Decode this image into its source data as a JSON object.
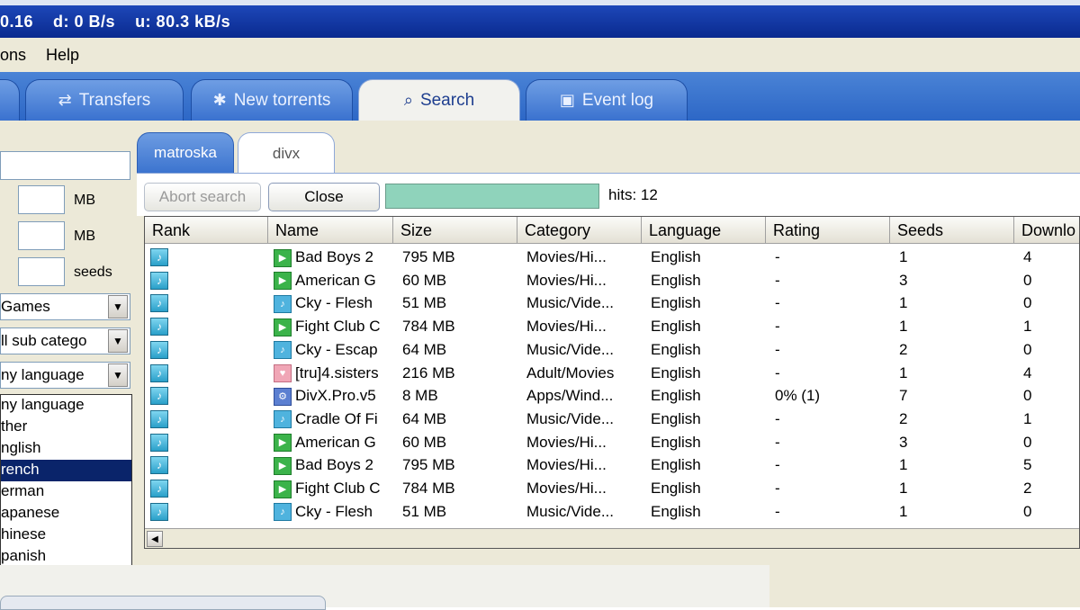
{
  "titlebar": {
    "version": "0.16",
    "download": "d: 0 B/s",
    "upload": "u: 80.3 kB/s"
  },
  "menu": {
    "items": [
      "ons",
      "Help"
    ]
  },
  "main_tabs": [
    {
      "label": "Transfers",
      "icon": "transfers-icon"
    },
    {
      "label": "New torrents",
      "icon": "new-torrents-icon"
    },
    {
      "label": "Search",
      "icon": "search-icon"
    },
    {
      "label": "Event log",
      "icon": "event-log-icon"
    }
  ],
  "left_panel": {
    "unit_mb_1": "MB",
    "unit_mb_2": "MB",
    "unit_seeds": "seeds",
    "category": "Games",
    "subcategory": "ll sub catego",
    "language": "ny language",
    "language_options": [
      "ny language",
      "ther",
      "nglish",
      "rench",
      "erman",
      "apanese",
      "hinese",
      "panish"
    ],
    "selected_language_index": 3
  },
  "sub_tabs": [
    "matroska",
    "divx"
  ],
  "toolbar": {
    "abort_label": "Abort search",
    "close_label": "Close",
    "hits": "hits: 12"
  },
  "table": {
    "columns": [
      "Rank",
      "Name",
      "Size",
      "Category",
      "Language",
      "Rating",
      "Seeds",
      "Downlo"
    ],
    "rows": [
      {
        "type": "video",
        "name": "Bad Boys 2",
        "size": "795 MB",
        "category": "Movies/Hi...",
        "language": "English",
        "rating": "-",
        "seeds": "1",
        "downloads": "4"
      },
      {
        "type": "video",
        "name": "American G",
        "size": "60 MB",
        "category": "Movies/Hi...",
        "language": "English",
        "rating": "-",
        "seeds": "3",
        "downloads": "0"
      },
      {
        "type": "music",
        "name": "Cky - Flesh",
        "size": "51 MB",
        "category": "Music/Vide...",
        "language": "English",
        "rating": "-",
        "seeds": "1",
        "downloads": "0"
      },
      {
        "type": "video",
        "name": "Fight Club C",
        "size": "784 MB",
        "category": "Movies/Hi...",
        "language": "English",
        "rating": "-",
        "seeds": "1",
        "downloads": "1"
      },
      {
        "type": "music",
        "name": "Cky - Escap",
        "size": "64 MB",
        "category": "Music/Vide...",
        "language": "English",
        "rating": "-",
        "seeds": "2",
        "downloads": "0"
      },
      {
        "type": "adult",
        "name": "[tru]4.sisters",
        "size": "216 MB",
        "category": "Adult/Movies",
        "language": "English",
        "rating": "-",
        "seeds": "1",
        "downloads": "4"
      },
      {
        "type": "app",
        "name": "DivX.Pro.v5",
        "size": "8 MB",
        "category": "Apps/Wind...",
        "language": "English",
        "rating": "0% (1)",
        "seeds": "7",
        "downloads": "0"
      },
      {
        "type": "music",
        "name": "Cradle Of Fi",
        "size": "64 MB",
        "category": "Music/Vide...",
        "language": "English",
        "rating": "-",
        "seeds": "2",
        "downloads": "1"
      },
      {
        "type": "video",
        "name": "American G",
        "size": "60 MB",
        "category": "Movies/Hi...",
        "language": "English",
        "rating": "-",
        "seeds": "3",
        "downloads": "0"
      },
      {
        "type": "video",
        "name": "Bad Boys 2",
        "size": "795 MB",
        "category": "Movies/Hi...",
        "language": "English",
        "rating": "-",
        "seeds": "1",
        "downloads": "5"
      },
      {
        "type": "video",
        "name": "Fight Club C",
        "size": "784 MB",
        "category": "Movies/Hi...",
        "language": "English",
        "rating": "-",
        "seeds": "1",
        "downloads": "2"
      },
      {
        "type": "music",
        "name": "Cky - Flesh",
        "size": "51 MB",
        "category": "Music/Vide...",
        "language": "English",
        "rating": "-",
        "seeds": "1",
        "downloads": "0"
      }
    ]
  },
  "colors": {
    "titlebar": "#0a2a8f",
    "tabbar": "#3a72cf",
    "progress": "#8fd3bb",
    "selection": "#0a246a"
  }
}
